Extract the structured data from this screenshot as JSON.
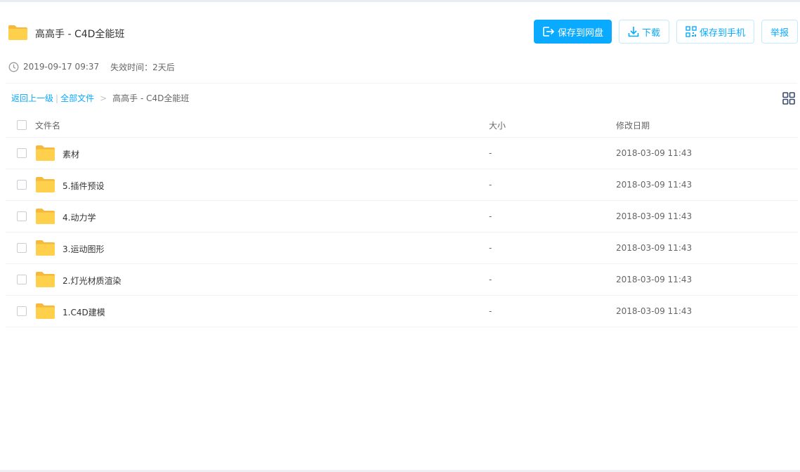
{
  "title": "高高手 - C4D全能班",
  "actions": {
    "save": "保存到网盘",
    "download": "下载",
    "save_phone": "保存到手机",
    "report": "举报"
  },
  "meta": {
    "date": "2019-09-17 09:37",
    "expire": "失效时间：2天后"
  },
  "breadcrumb": {
    "back": "返回上一级",
    "separator": "|",
    "all_files": "全部文件",
    "arrow": ">",
    "current": "高高手 - C4D全能班"
  },
  "columns": {
    "name": "文件名",
    "size": "大小",
    "date": "修改日期"
  },
  "files": [
    {
      "name": "素材",
      "size": "-",
      "date": "2018-03-09 11:43"
    },
    {
      "name": "5.插件预设",
      "size": "-",
      "date": "2018-03-09 11:43"
    },
    {
      "name": "4.动力学",
      "size": "-",
      "date": "2018-03-09 11:43"
    },
    {
      "name": "3.运动图形",
      "size": "-",
      "date": "2018-03-09 11:43"
    },
    {
      "name": "2.灯光材质渲染",
      "size": "-",
      "date": "2018-03-09 11:43"
    },
    {
      "name": "1.C4D建模",
      "size": "-",
      "date": "2018-03-09 11:43"
    }
  ],
  "icons": {
    "folder": "folder-icon",
    "clock": "clock-icon",
    "save": "save-to-disk-icon",
    "download": "download-icon",
    "phone": "qr-phone-icon",
    "grid": "grid-view-icon"
  },
  "colors": {
    "accent": "#09aaff",
    "folder": "#ffd04b",
    "folder_dark": "#f6b93b",
    "text": "#333333",
    "muted": "#666666"
  }
}
